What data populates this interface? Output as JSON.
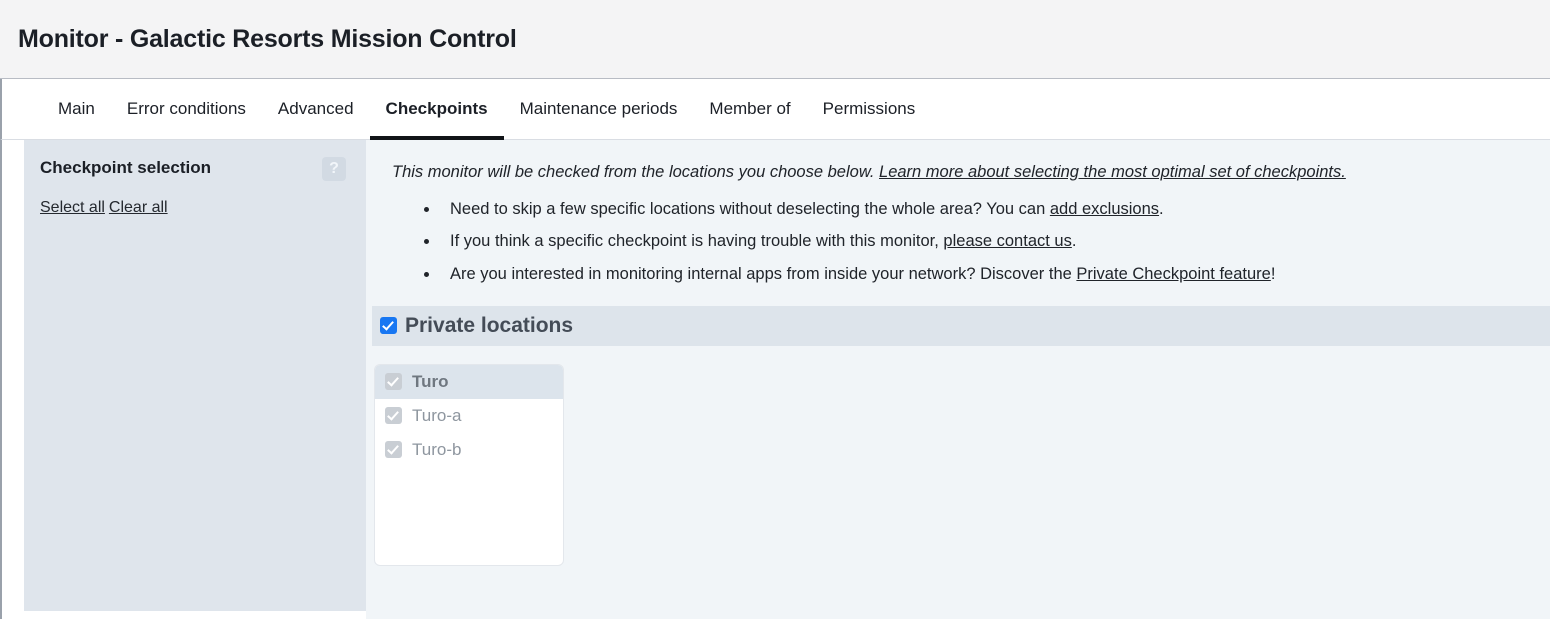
{
  "header": {
    "title": "Monitor - Galactic Resorts Mission Control"
  },
  "tabs": [
    {
      "label": "Main",
      "active": false
    },
    {
      "label": "Error conditions",
      "active": false
    },
    {
      "label": "Advanced",
      "active": false
    },
    {
      "label": "Checkpoints",
      "active": true
    },
    {
      "label": "Maintenance periods",
      "active": false
    },
    {
      "label": "Member of",
      "active": false
    },
    {
      "label": "Permissions",
      "active": false
    }
  ],
  "sidebar": {
    "title": "Checkpoint selection",
    "help_badge": "?",
    "select_all_label": "Select all",
    "clear_all_label": "Clear all"
  },
  "main": {
    "intro": {
      "text": "This monitor will be checked from the locations you choose below.",
      "link": "Learn more about selecting the most optimal set of checkpoints."
    },
    "bullets": [
      {
        "before": "Need to skip a few specific locations without deselecting the whole area? You can ",
        "link": "add exclusions",
        "after": "."
      },
      {
        "before": "If you think a specific checkpoint is having trouble with this monitor, ",
        "link": "please contact us",
        "after": "."
      },
      {
        "before": "Are you interested in monitoring internal apps from inside your network? Discover the ",
        "link": "Private Checkpoint feature",
        "after": "!"
      }
    ],
    "group": {
      "title": "Private locations",
      "checked": true,
      "locations": [
        {
          "label": "Turo",
          "checked": true,
          "disabled": true,
          "selected": true
        },
        {
          "label": "Turo-a",
          "checked": true,
          "disabled": true,
          "selected": false
        },
        {
          "label": "Turo-b",
          "checked": true,
          "disabled": true,
          "selected": false
        }
      ]
    }
  },
  "colors": {
    "accent": "#1877f2",
    "header_bg": "#f4f4f5",
    "sidebar_bg": "#dfe5ec",
    "content_bg": "#f1f5f8",
    "group_bar_bg": "#dde4eb"
  }
}
